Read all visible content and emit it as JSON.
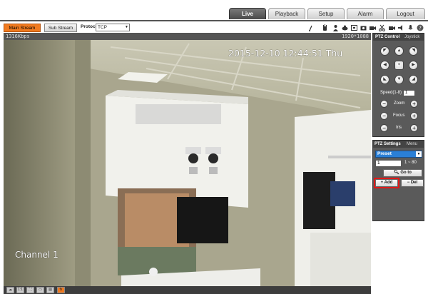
{
  "nav": {
    "tabs": [
      {
        "label": "Live",
        "active": true
      },
      {
        "label": "Playback",
        "active": false
      },
      {
        "label": "Setup",
        "active": false
      },
      {
        "label": "Alarm",
        "active": false
      },
      {
        "label": "Logout",
        "active": false
      }
    ]
  },
  "toolbar": {
    "main_stream": "Main Stream",
    "sub_stream": "Sub Stream",
    "protocol_label": "Protocol",
    "protocol_value": "TCP",
    "icons": [
      "wiper-icon",
      "hand-icon",
      "person-icon",
      "fisheye-icon",
      "zoom-icon",
      "snapshot-icon",
      "record-icon",
      "speaker-icon",
      "microphone-icon",
      "help-icon"
    ]
  },
  "video": {
    "bitrate": "1316Kbps",
    "resolution": "1920*1088",
    "timestamp": "2015-12-10 12:44:51 Thu",
    "channel": "Channel 1"
  },
  "ptz_control": {
    "tab_control": "PTZ Control",
    "tab_joystick": "Joystick",
    "speed_label": "Speed(1-8)",
    "speed_value": "1",
    "zoom_label": "Zoom",
    "focus_label": "Focus",
    "iris_label": "Iris"
  },
  "ptz_settings": {
    "tab_settings": "PTZ Settings",
    "tab_menu": "Menu",
    "preset_value": "Preset",
    "preset_number": "1",
    "range": "1 ~ 80",
    "goto_label": "Go to",
    "add_label": "Add",
    "del_label": "Del"
  },
  "colors": {
    "accent": "#f07a20",
    "panel": "#5a5a5a",
    "highlight": "#e01818",
    "preset_blue": "#2a7fd6"
  }
}
